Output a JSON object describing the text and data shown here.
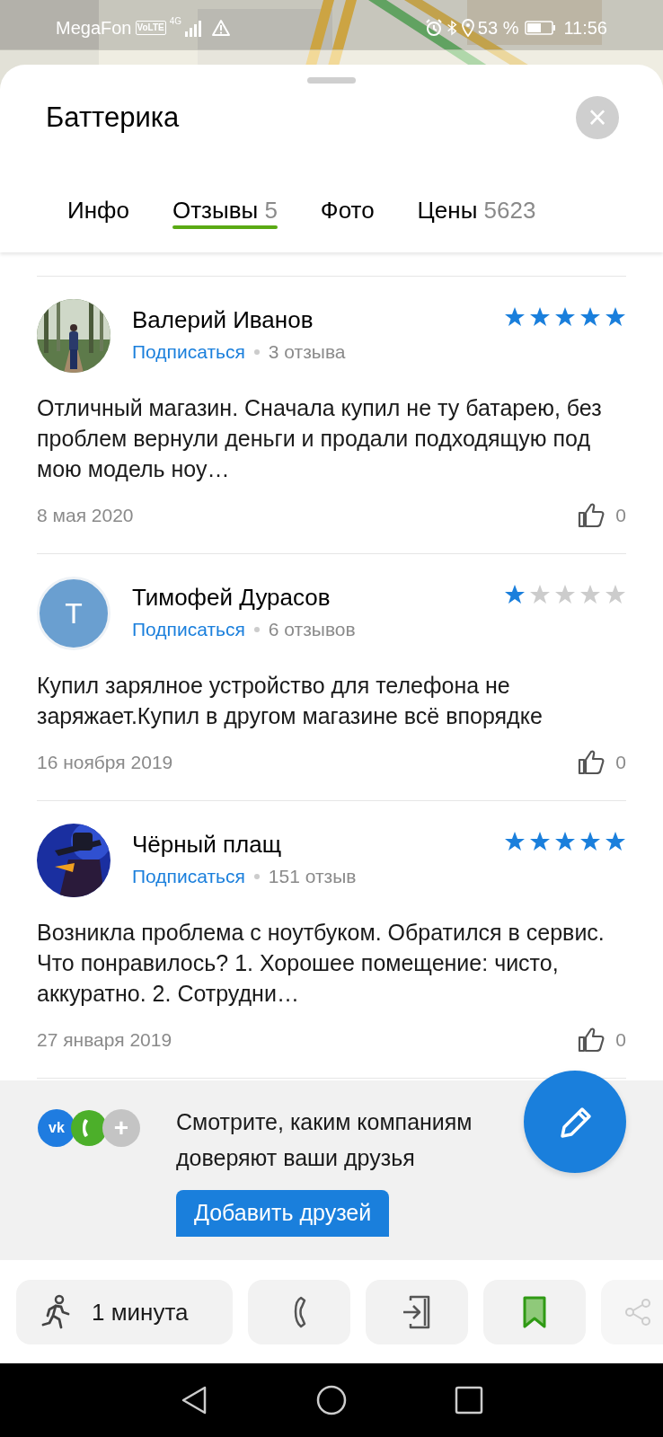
{
  "status_bar": {
    "carrier": "MegaFon",
    "volte": "VoLTE",
    "network": "4G",
    "battery_percent": "53 %",
    "time": "11:56"
  },
  "place": {
    "title": "Баттерика",
    "close": "×"
  },
  "tabs": [
    {
      "label": "Инфо",
      "selected": false
    },
    {
      "label": "Отзывы",
      "count": "5",
      "selected": true
    },
    {
      "label": "Фото",
      "selected": false
    },
    {
      "label": "Цены",
      "count": "5623",
      "selected": false
    }
  ],
  "reviews": [
    {
      "name": "Валерий Иванов",
      "subscribe": "Подписаться",
      "review_count": "3 отзыва",
      "stars": 5,
      "text": "Отличный магазин. Сначала купил не ту батарею, без проблем вернули деньги и продали подходящую под мою модель ноу…",
      "date": "8 мая 2020",
      "likes": "0"
    },
    {
      "avatar": {
        "kind": "letter",
        "letter": "Т",
        "color": "#6a9fd0"
      },
      "name": "Тимофей Дурасов",
      "subscribe": "Подписаться",
      "review_count": "6 отзывов",
      "stars": 1,
      "text": "Купил зарялное устройство для телефона не заряжает.Купил в другом магазине всё впорядке",
      "date": "16 ноября 2019",
      "likes": "0"
    },
    {
      "name": "Чёрный плащ",
      "subscribe": "Подписаться",
      "review_count": "151 отзыв",
      "stars": 5,
      "text": "Возникла проблема с ноутбуком. Обратился в сервис. Что понравилось? 1. Хорошее помещение: чисто, аккуратно. 2. Сотрудни…",
      "date": "27 января 2019",
      "likes": "0"
    }
  ],
  "friends_promo": {
    "sources": [
      {
        "kind": "vk",
        "glyph": "vk",
        "color": "#1f7ce0"
      },
      {
        "kind": "phone",
        "color": "#4caf2a"
      },
      {
        "kind": "add",
        "glyph": "+",
        "color": "#c4c4c4"
      }
    ],
    "text": "Смотрите, каким компаниям доверяют ваши друзья",
    "button": "Добавить друзей"
  },
  "actions": [
    {
      "kind": "route",
      "label": "1 минута"
    },
    {
      "kind": "call"
    },
    {
      "kind": "entrance"
    },
    {
      "kind": "bookmark",
      "saved": true
    },
    {
      "kind": "share"
    }
  ]
}
